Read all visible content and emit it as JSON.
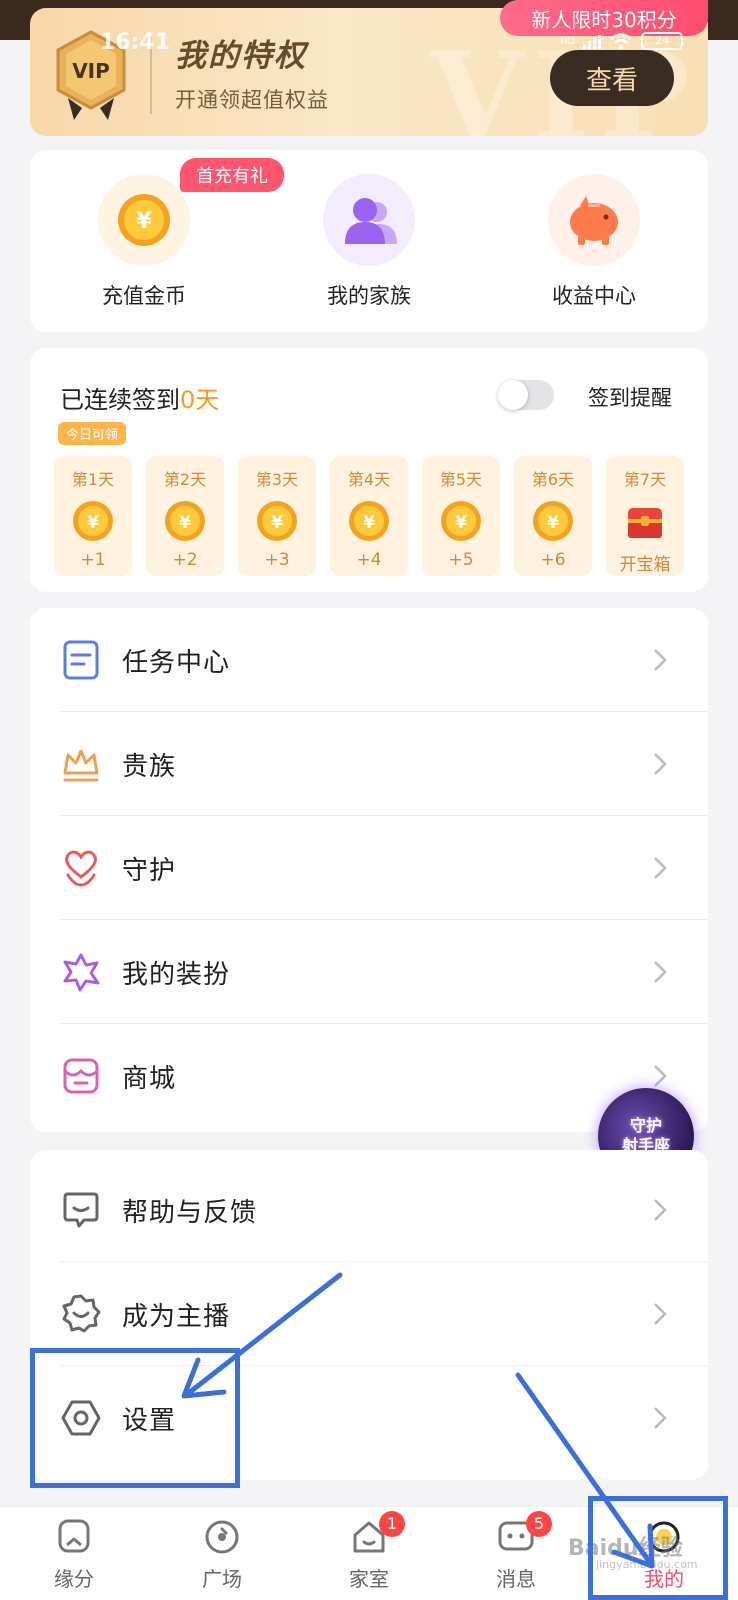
{
  "status_bar": {
    "time": "16:41",
    "network": "HD",
    "battery": "24"
  },
  "vip": {
    "badge_text": "VIP",
    "watermark": "VIP",
    "title": "我的特权",
    "subtitle": "开通领超值权益",
    "view_button": "查看",
    "promo": "新人限时30积分"
  },
  "quick_actions": {
    "tag": "首充有礼",
    "items": [
      {
        "label": "充值金币",
        "icon": "gold-coin-icon"
      },
      {
        "label": "我的家族",
        "icon": "family-group-icon"
      },
      {
        "label": "收益中心",
        "icon": "piggy-bank-icon"
      }
    ]
  },
  "checkin": {
    "title_prefix": "已连续签到",
    "days_count": "0天",
    "remind_label": "签到提醒",
    "remind_enabled": false,
    "today_tag": "今日可领",
    "days": [
      {
        "name": "第1天",
        "reward": "+1"
      },
      {
        "name": "第2天",
        "reward": "+2"
      },
      {
        "name": "第3天",
        "reward": "+3"
      },
      {
        "name": "第4天",
        "reward": "+4"
      },
      {
        "name": "第5天",
        "reward": "+5"
      },
      {
        "name": "第6天",
        "reward": "+6"
      },
      {
        "name": "第7天",
        "reward": "开宝箱"
      }
    ]
  },
  "menu_main": [
    {
      "label": "任务中心",
      "icon": "task-document-icon",
      "color": "#5b7fe0"
    },
    {
      "label": "贵族",
      "icon": "crown-icon",
      "color": "#f0a050"
    },
    {
      "label": "守护",
      "icon": "heart-hands-icon",
      "color": "#ee5a5a"
    },
    {
      "label": "我的装扮",
      "icon": "star-burst-icon",
      "color": "#a860e0"
    },
    {
      "label": "商城",
      "icon": "shop-icon",
      "color": "#e060b0"
    }
  ],
  "menu_secondary": [
    {
      "label": "帮助与反馈",
      "icon": "feedback-chat-icon"
    },
    {
      "label": "成为主播",
      "icon": "anchor-badge-icon"
    },
    {
      "label": "设置",
      "icon": "settings-hexagon-icon"
    }
  ],
  "float_badge": {
    "line1": "守护",
    "line2": "射手座"
  },
  "bottom_nav": [
    {
      "label": "缘分",
      "badge": ""
    },
    {
      "label": "广场",
      "badge": ""
    },
    {
      "label": "家室",
      "badge": "1"
    },
    {
      "label": "消息",
      "badge": "5"
    },
    {
      "label": "我的",
      "badge": ""
    }
  ],
  "watermark": {
    "main": "Baidu经验",
    "sub": "jingyan.baidu.com"
  },
  "colors": {
    "accent": "#ff4d6f",
    "gold": "#ff9a1f",
    "annotation": "#3c6fd8"
  }
}
